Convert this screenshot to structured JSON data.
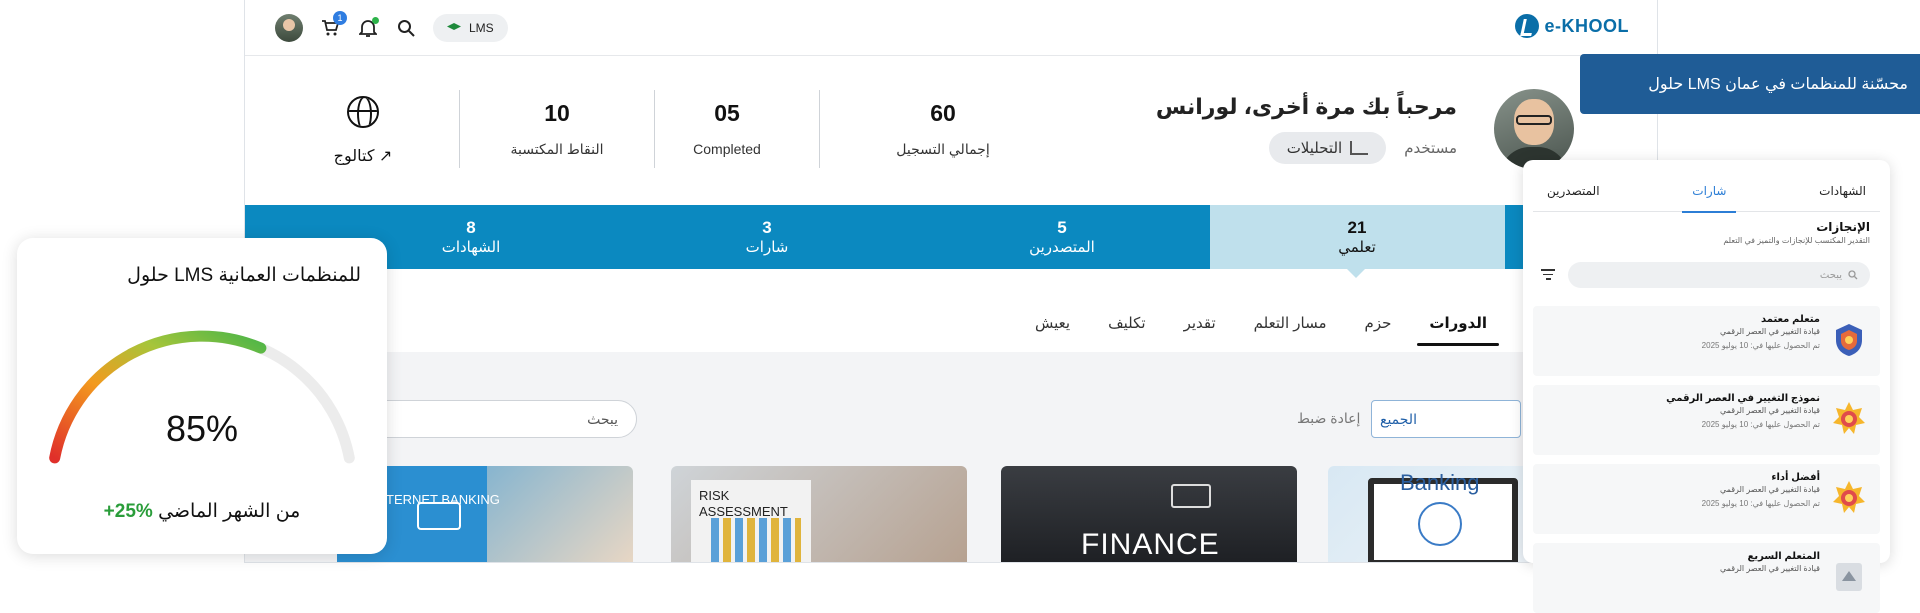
{
  "brand": {
    "logo_text": "e-KHOOL"
  },
  "topbar": {
    "lms_label": "LMS",
    "cart_count": "1"
  },
  "callout": {
    "text": "حلول LMS محسّنة للمنظمات في عمان"
  },
  "welcome": {
    "greeting": "مرحباً بك مرة أخرى، لورانس",
    "role": "مستخدم",
    "analytics_label": "التحليلات"
  },
  "stats": [
    {
      "value": "60",
      "label": "إجمالي التسجيل"
    },
    {
      "value": "05",
      "label": "Completed"
    },
    {
      "value": "10",
      "label": "النقاط المكتسبة"
    }
  ],
  "catalog": {
    "label": "كتالوج"
  },
  "band": [
    {
      "value": "21",
      "label": "تعلمي"
    },
    {
      "value": "5",
      "label": "المتصدرين"
    },
    {
      "value": "3",
      "label": "شارات"
    },
    {
      "value": "8",
      "label": "الشهادات"
    }
  ],
  "tabs": [
    "الدورات",
    "حزم",
    "مسار التعلم",
    "تقدير",
    "تكليف",
    "يعيش"
  ],
  "filters": {
    "select_value": "الجميع",
    "reset_label": "إعادة ضبط",
    "search_placeholder": "يبحث"
  },
  "thumbs": [
    {
      "caption": "Banking"
    },
    {
      "caption": "FINANCE"
    },
    {
      "caption": "RISK ASSESSMENT"
    },
    {
      "caption": "INTERNET BANKING"
    }
  ],
  "panel": {
    "tabs": [
      "الشهادات",
      "شارات",
      "المتصدرين"
    ],
    "title": "الإنجازات",
    "subtitle": "التقدير المكتسب للإنجازات والتميز في التعلم",
    "search_placeholder": "يبحث",
    "items": [
      {
        "title": "متعلم معتمد",
        "sub": "قيادة التغيير في العصر الرقمي",
        "date": "تم الحصول عليها في: 10 يوليو 2025"
      },
      {
        "title": "نموذج التغيير في العصر الرقمي",
        "sub": "قيادة التغيير في العصر الرقمي",
        "date": "تم الحصول عليها في: 10 يوليو 2025"
      },
      {
        "title": "أفضل أداء",
        "sub": "قيادة التغيير في العصر الرقمي",
        "date": "تم الحصول عليها في: 10 يوليو 2025"
      },
      {
        "title": "المتعلم السريع",
        "sub": "قيادة التغيير في العصر الرقمي",
        "date": ""
      }
    ]
  },
  "gauge": {
    "title": "حلول LMS للمنظمات العمانية",
    "value": "85%",
    "value_fraction": 0.85,
    "change": "+25%",
    "change_suffix": "من الشهر الماضي"
  },
  "colors": {
    "brand": "#0a6ea8",
    "band": "#0b89c0",
    "band_active": "#bfe0ec",
    "callout": "#1f5c96",
    "gauge_good": "#2a9d3a"
  }
}
